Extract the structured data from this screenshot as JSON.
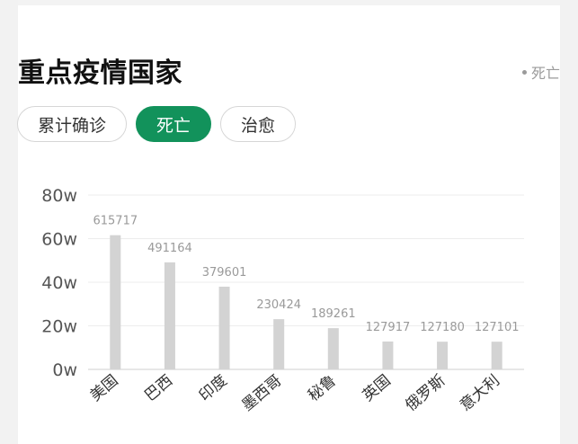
{
  "header": {
    "title": "重点疫情国家",
    "legend_label": "死亡"
  },
  "tabs": [
    {
      "label": "累计确诊",
      "active": false
    },
    {
      "label": "死亡",
      "active": true
    },
    {
      "label": "治愈",
      "active": false
    }
  ],
  "colors": {
    "accent": "#12925b",
    "bar": "#d3d3d3",
    "label": "#9a9a9a"
  },
  "chart_data": {
    "type": "bar",
    "categories": [
      "美国",
      "巴西",
      "印度",
      "墨西哥",
      "秘鲁",
      "英国",
      "俄罗斯",
      "意大利"
    ],
    "values": [
      615717,
      491164,
      379601,
      230424,
      189261,
      127917,
      127180,
      127101
    ],
    "data_labels": [
      "615717",
      "491164",
      "379601",
      "230424",
      "189261",
      "127917",
      "127180",
      "127101"
    ],
    "y_ticks": [
      0,
      200000,
      400000,
      600000,
      800000
    ],
    "y_tick_labels": [
      "0w",
      "20w",
      "40w",
      "60w",
      "80w"
    ],
    "ylim": [
      0,
      800000
    ],
    "grid": true
  }
}
